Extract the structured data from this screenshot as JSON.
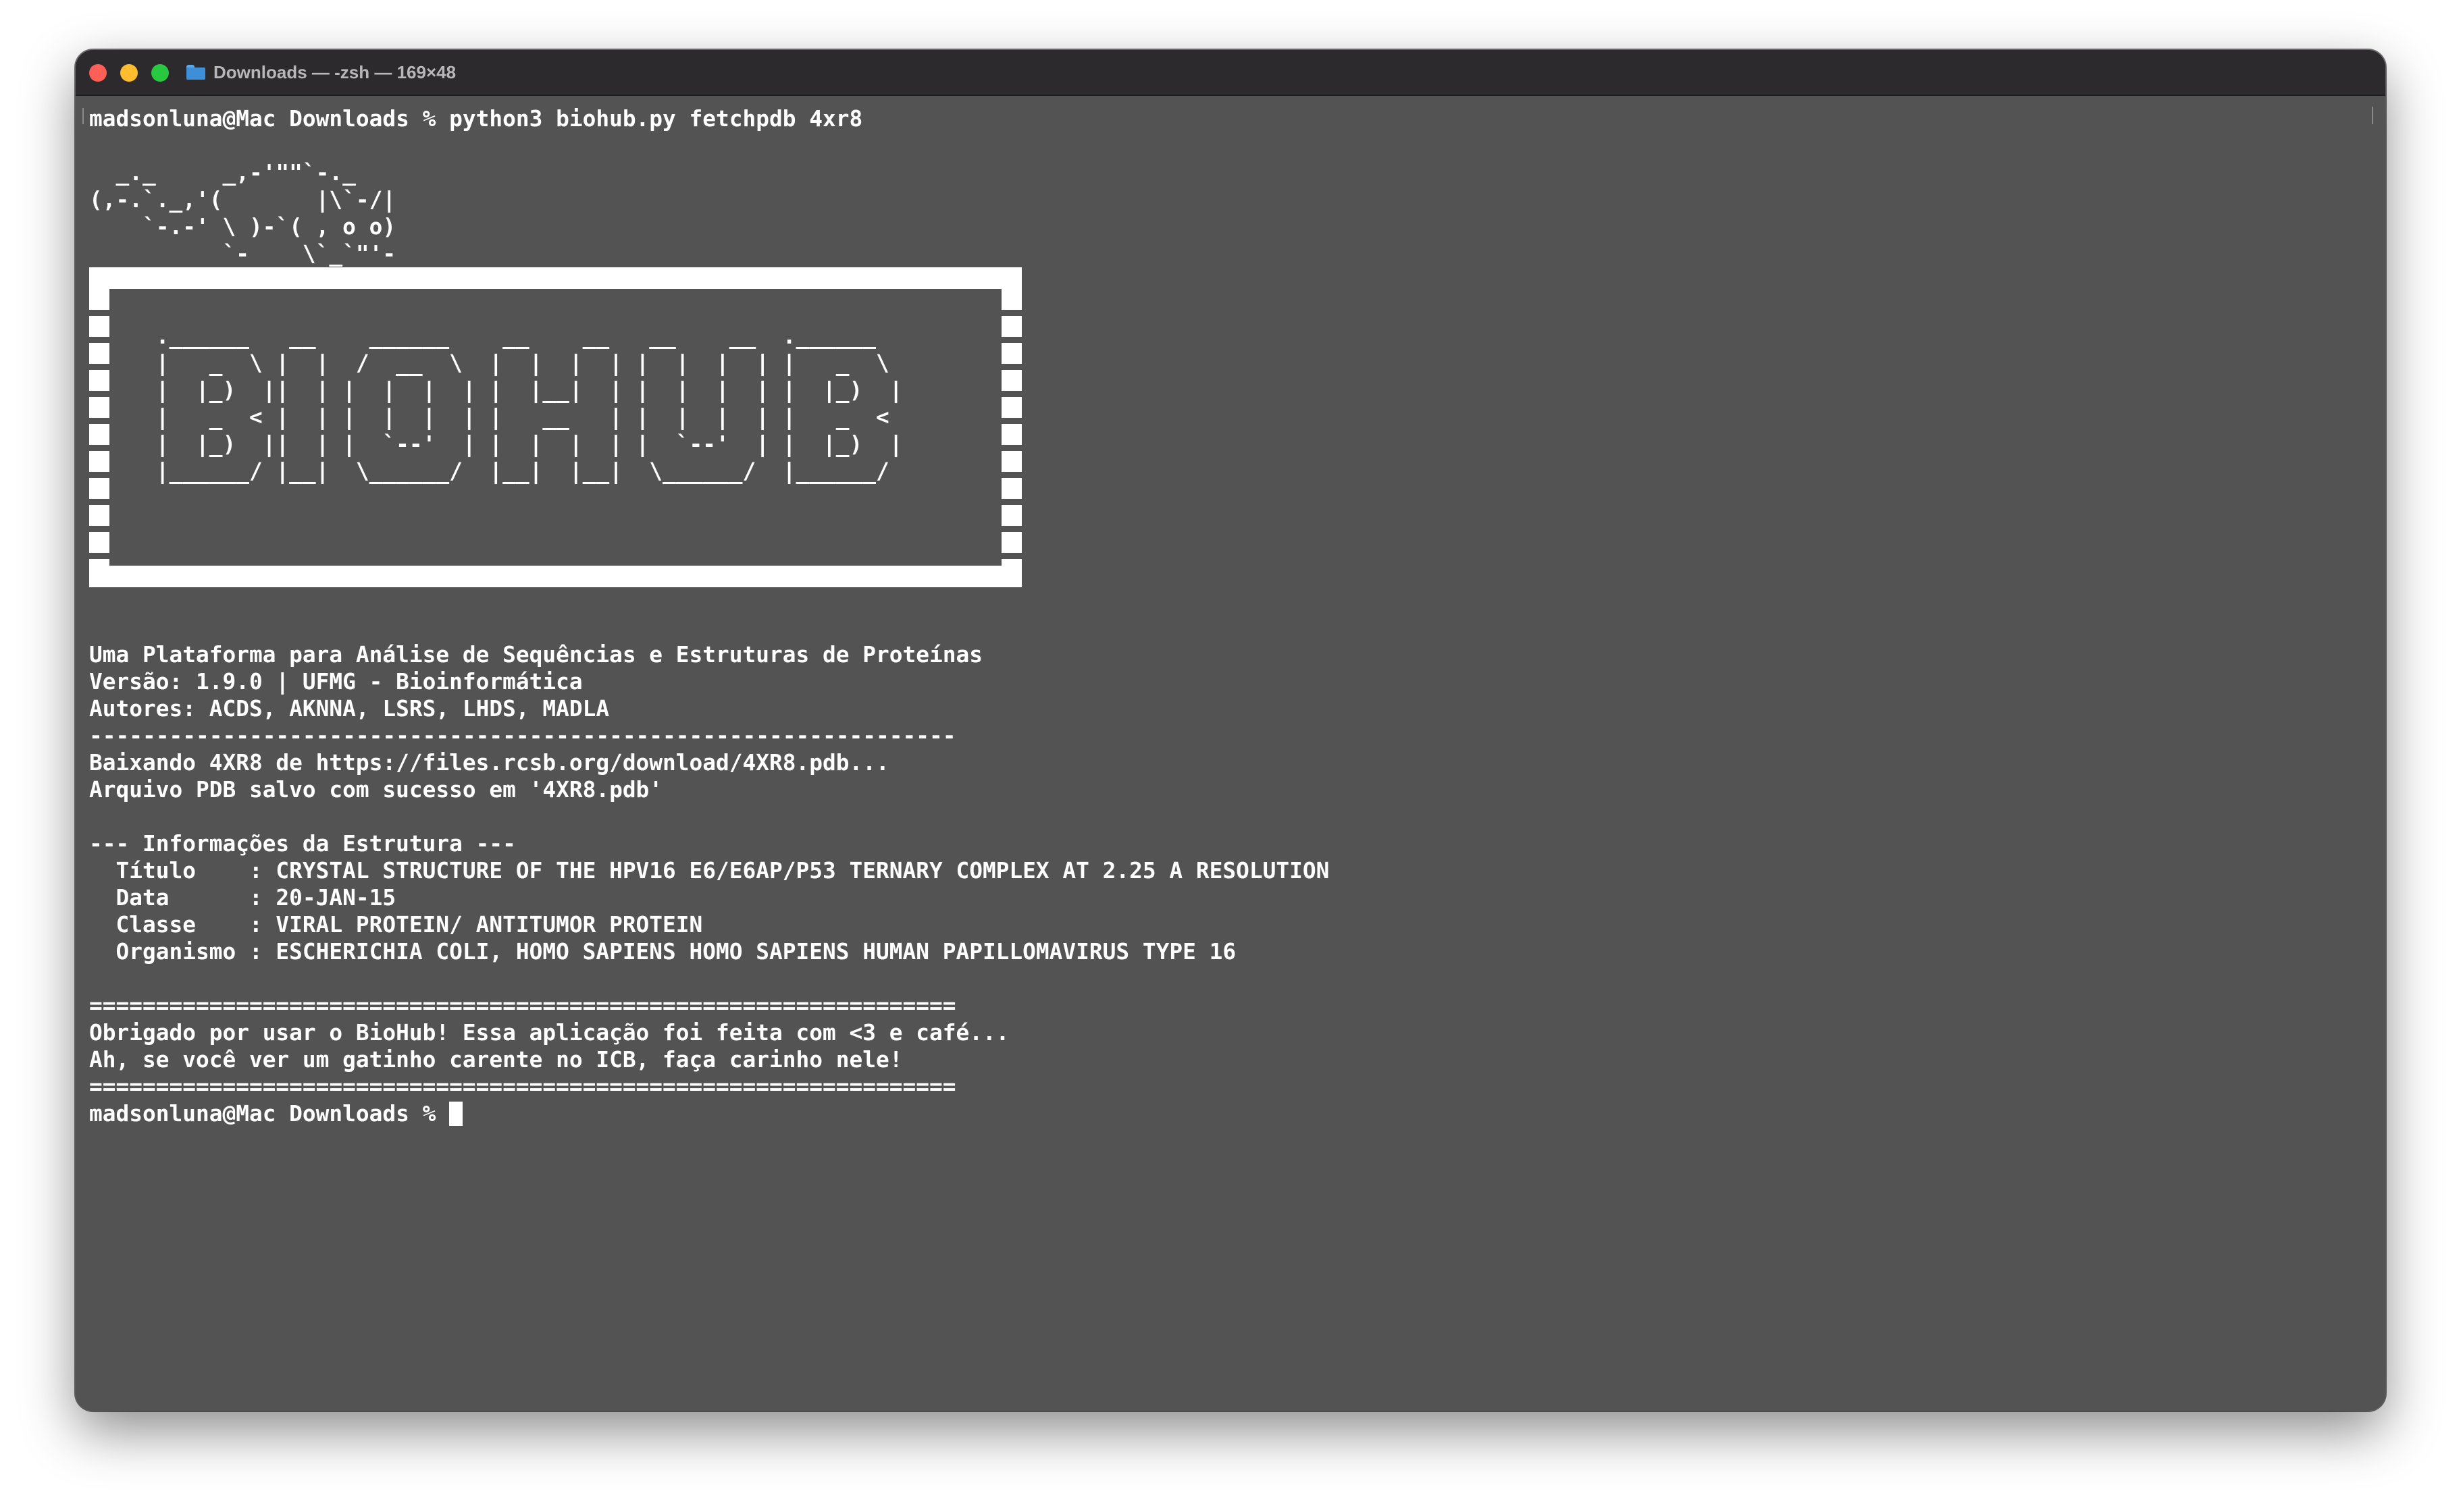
{
  "window": {
    "title": "Downloads — -zsh — 169×48",
    "folder_icon": "folder-icon",
    "colors": {
      "background": "#535353",
      "titlebar": "#2c2a2d",
      "text": "#ffffff",
      "close": "#ff5f57",
      "minimize": "#febc2e",
      "zoom": "#28c840"
    }
  },
  "terminal": {
    "command_line": "madsonluna@Mac Downloads % python3 biohub.py fetchpdb 4xr8",
    "ascii_cat": [
      "  _._     _,-'\"\"`-._",
      "(,-.`._,'(       |\\`-/|",
      "    `-.-' \\ )-`( , o o)",
      "          `-    \\`_`\"'-"
    ],
    "ascii_logo": [
      " ",
      "     .______   __    ______    __    __   __    __  .______",
      "     |   _  \\ |  |  /  __  \\  |  |  |  | |  |  |  | |   _  \\",
      "     |  |_)  ||  | |  |  |  | |  |__|  | |  |  |  | |  |_)  |",
      "     |   _  < |  | |  |  |  | |   __   | |  |  |  | |   _  <",
      "     |  |_)  ||  | |  `--'  | |  |  |  | |  `--'  | |  |_)  |",
      "     |______/ |__|  \\______/  |__|  |__|  \\______/  |______/",
      " ",
      " "
    ],
    "info_lines": [
      "Uma Plataforma para Análise de Sequências e Estruturas de Proteínas",
      "Versão: 1.9.0 | UFMG - Bioinformática",
      "Autores: ACDS, AKNNA, LSRS, LHDS, MADLA",
      "-----------------------------------------------------------------",
      "Baixando 4XR8 de https://files.rcsb.org/download/4XR8.pdb...",
      "Arquivo PDB salvo com sucesso em '4XR8.pdb'"
    ],
    "structure_header": "--- Informações da Estrutura ---",
    "structure_fields": [
      "  Título    : CRYSTAL STRUCTURE OF THE HPV16 E6/E6AP/P53 TERNARY COMPLEX AT 2.25 A RESOLUTION",
      "  Data      : 20-JAN-15",
      "  Classe    : VIRAL PROTEIN/ ANTITUMOR PROTEIN",
      "  Organismo : ESCHERICHIA COLI, HOMO SAPIENS HOMO SAPIENS HUMAN PAPILLOMAVIRUS TYPE 16"
    ],
    "separator": "=================================================================",
    "thanks_lines": [
      "Obrigado por usar o BioHub! Essa aplicação foi feita com <3 e café...",
      "Ah, se você ver um gatinho carente no ICB, faça carinho nele!"
    ],
    "prompt": "madsonluna@Mac Downloads % "
  }
}
